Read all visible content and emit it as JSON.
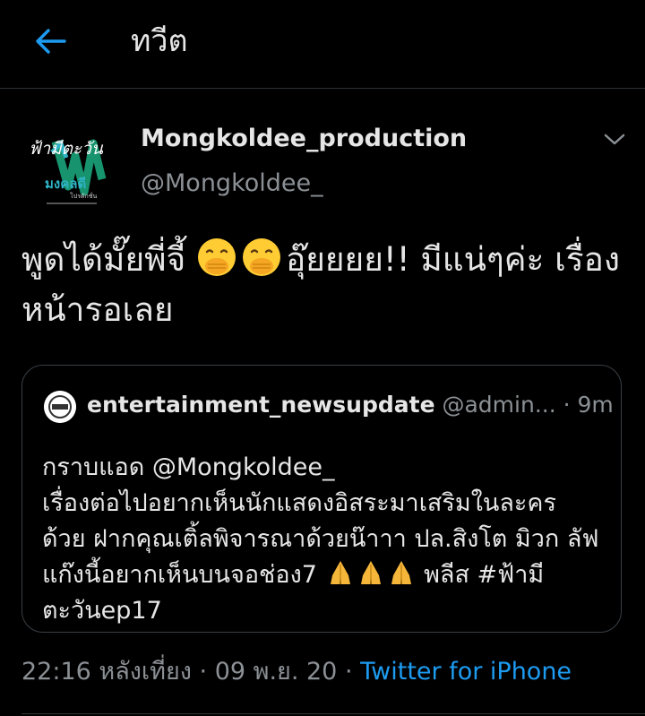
{
  "header": {
    "title": "ทวีต",
    "back_icon": "arrow-left-icon",
    "accent_color": "#1d9bf0"
  },
  "author": {
    "name": "Mongkoldee_production",
    "handle": "@Mongkoldee_",
    "avatar_text_top": "ฟ้ามีตะวัน",
    "avatar_text_bottom": "มงคลดี",
    "avatar_text_small": "โปรดักชั่น"
  },
  "tweet": {
    "text_before_emoji": "พูดได้มั๊ยพี่จี้ ",
    "text_after_emoji": "อุ๊ยยยย!! มีแน่ๆค่ะ เรื่องหน้ารอเลย",
    "emoji": "face-with-hand-over-mouth-icon"
  },
  "quote": {
    "name": "entertainment_newsupdate",
    "handle": "@admin...",
    "separator": " · ",
    "time": "9m",
    "text_part1": "กราบแอด @Mongkoldee_\nเรื่องต่อไปอยากเห็นนักแสดงอิสระมาเสริมในละคร ด้วย ฝากคุณเติ้ลพิจารณาด้วยน๊าาา ปล.สิงโต มิวก ลัฟ แก๊งนี้อยากเห็นบนจอช่อง7 ",
    "text_part2": " พลีส #ฟ้ามีตะวันep17",
    "emoji": "folded-hands-icon"
  },
  "meta": {
    "time": "22:16 หลังเที่ยง",
    "separator": " · ",
    "date": "09 พ.ย. 20",
    "source": "Twitter for iPhone"
  }
}
